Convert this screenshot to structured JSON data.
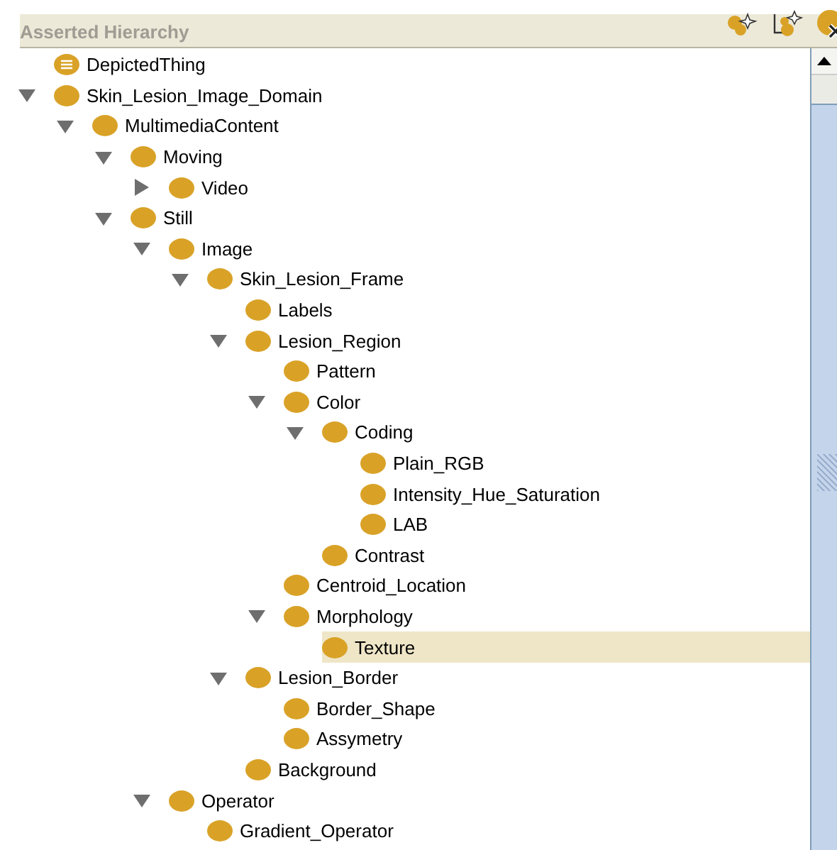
{
  "panel": {
    "title": "Asserted Hierarchy"
  },
  "tree": [
    {
      "label": "DepictedThing",
      "kind": "defined",
      "selected": false
    },
    {
      "label": "Skin_Lesion_Image_Domain",
      "kind": "class",
      "expanded": true,
      "selected": false,
      "children": [
        {
          "label": "MultimediaContent",
          "kind": "class",
          "expanded": true,
          "selected": false,
          "children": [
            {
              "label": "Moving",
              "kind": "class",
              "expanded": true,
              "selected": false,
              "children": [
                {
                  "label": "Video",
                  "kind": "class",
                  "expanded": false,
                  "selected": false
                }
              ]
            },
            {
              "label": "Still",
              "kind": "class",
              "expanded": true,
              "selected": false,
              "children": [
                {
                  "label": "Image",
                  "kind": "class",
                  "expanded": true,
                  "selected": false,
                  "children": [
                    {
                      "label": "Skin_Lesion_Frame",
                      "kind": "class",
                      "expanded": true,
                      "selected": false,
                      "children": [
                        {
                          "label": "Labels",
                          "kind": "class",
                          "selected": false
                        },
                        {
                          "label": "Lesion_Region",
                          "kind": "class",
                          "expanded": true,
                          "selected": false,
                          "children": [
                            {
                              "label": "Pattern",
                              "kind": "class",
                              "selected": false
                            },
                            {
                              "label": "Color",
                              "kind": "class",
                              "expanded": true,
                              "selected": false,
                              "children": [
                                {
                                  "label": "Coding",
                                  "kind": "class",
                                  "expanded": true,
                                  "selected": false,
                                  "children": [
                                    {
                                      "label": "Plain_RGB",
                                      "kind": "class",
                                      "selected": false
                                    },
                                    {
                                      "label": "Intensity_Hue_Saturation",
                                      "kind": "class",
                                      "selected": false
                                    },
                                    {
                                      "label": "LAB",
                                      "kind": "class",
                                      "selected": false
                                    }
                                  ]
                                },
                                {
                                  "label": "Contrast",
                                  "kind": "class",
                                  "selected": false
                                }
                              ]
                            },
                            {
                              "label": "Centroid_Location",
                              "kind": "class",
                              "selected": false
                            },
                            {
                              "label": "Morphology",
                              "kind": "class",
                              "expanded": true,
                              "selected": false,
                              "children": [
                                {
                                  "label": "Texture",
                                  "kind": "class",
                                  "selected": true
                                }
                              ]
                            }
                          ]
                        },
                        {
                          "label": "Lesion_Border",
                          "kind": "class",
                          "expanded": true,
                          "selected": false,
                          "children": [
                            {
                              "label": "Border_Shape",
                              "kind": "class",
                              "selected": false
                            },
                            {
                              "label": "Assymetry",
                              "kind": "class",
                              "selected": false
                            }
                          ]
                        },
                        {
                          "label": "Background",
                          "kind": "class",
                          "selected": false
                        }
                      ]
                    }
                  ]
                },
                {
                  "label": "Operator",
                  "kind": "class",
                  "expanded": true,
                  "selected": false,
                  "children": [
                    {
                      "label": "Gradient_Operator",
                      "kind": "class",
                      "selected": false
                    }
                  ]
                }
              ]
            }
          ]
        }
      ]
    }
  ]
}
